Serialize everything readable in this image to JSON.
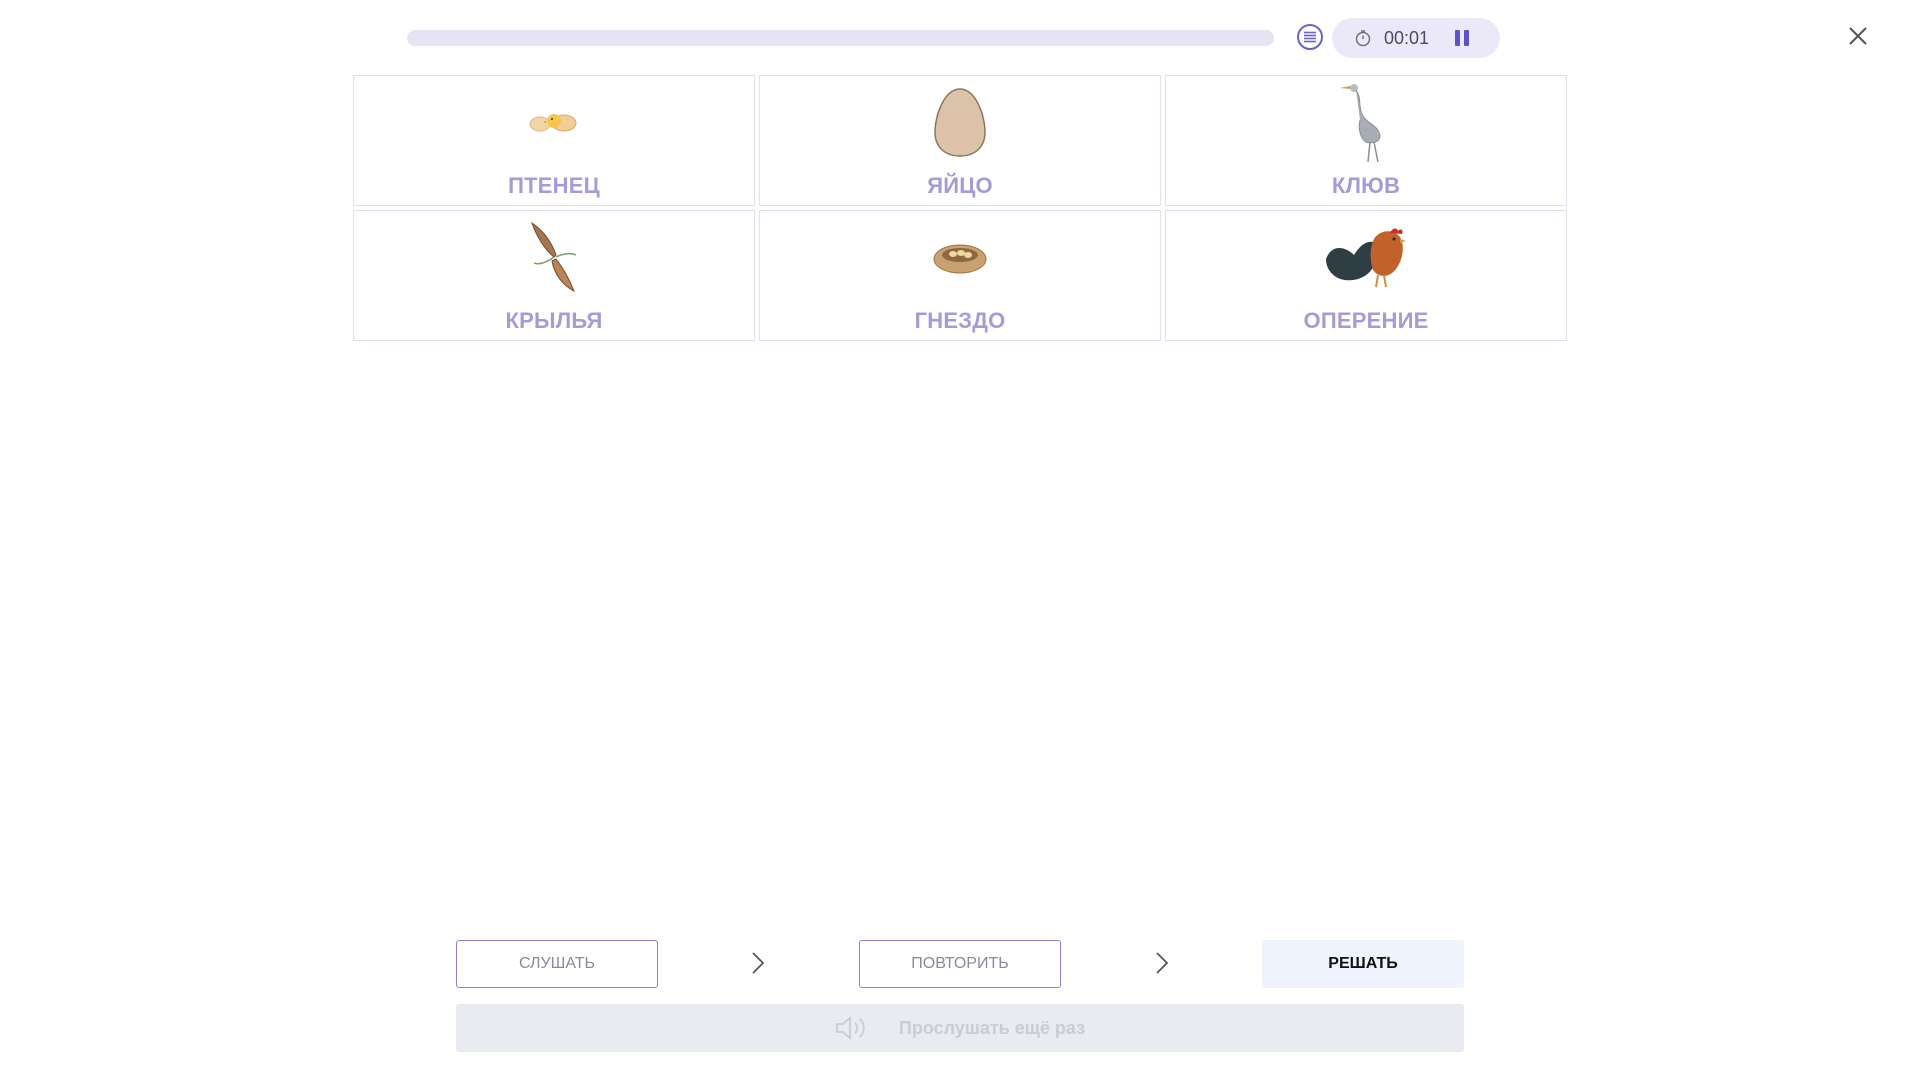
{
  "header": {
    "progress": 0,
    "timer": "00:01"
  },
  "cards": [
    {
      "label": "ПТЕНЕЦ",
      "icon": "chick-icon"
    },
    {
      "label": "ЯЙЦО",
      "icon": "egg-icon"
    },
    {
      "label": "КЛЮВ",
      "icon": "heron-icon"
    },
    {
      "label": "КРЫЛЬЯ",
      "icon": "wings-icon"
    },
    {
      "label": "ГНЕЗДО",
      "icon": "nest-icon"
    },
    {
      "label": "ОПЕРЕНИЕ",
      "icon": "rooster-icon"
    }
  ],
  "steps": {
    "listen": "СЛУШАТЬ",
    "repeat": "ПОВТОРИТЬ",
    "solve": "РЕШАТЬ"
  },
  "listen_again": "Прослушать ещё раз",
  "colors": {
    "accent": "#8a83dd",
    "label": "#a79ad8",
    "progress_track": "#e6e4f2",
    "timer_bg": "#ebe9f7",
    "solve_bg": "#eef3fd",
    "listen_again_bg": "#e8ebf0"
  }
}
